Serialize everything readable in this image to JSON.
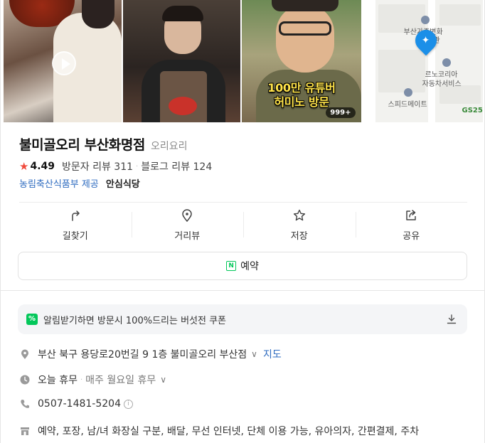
{
  "photos": {
    "caption_line1": "100만 유튜버",
    "caption_line2": "허미노 방문",
    "more_count": "999+",
    "map_labels": {
      "label1": "부산가족변화",
      "label1b": "관",
      "label2": "르노코리아",
      "label2b": "자동차서비스",
      "label3": "스피드메이트",
      "label4": "GS25"
    }
  },
  "place": {
    "name": "불미골오리 부산화명점",
    "category": "오리요리",
    "rating": "4.49",
    "visitor_reviews": "방문자 리뷰 311",
    "blog_reviews": "블로그 리뷰 124",
    "provider": "농림축산식품부 제공",
    "provider_badge": "안심식당"
  },
  "actions": {
    "directions": "길찾기",
    "street_view": "거리뷰",
    "save": "저장",
    "share": "공유",
    "reserve": "예약",
    "reserve_icon_letter": "N"
  },
  "coupon": {
    "icon": "%",
    "text": "알림받기하면 방문시 100%드리는 버섯전 쿠폰"
  },
  "info": {
    "address": "부산 북구 용당로20번길 9 1층 불미골오리 부산점",
    "map_link": "지도",
    "status": "오늘 휴무",
    "hours_note": "매주 월요일 휴무",
    "phone": "0507-1481-5204",
    "amenities": "예약, 포장, 남/녀 화장실 구분, 배달, 무선 인터넷, 단체 이용 가능, 유아의자, 간편결제, 주차"
  },
  "colors": {
    "accent_green": "#03c75a",
    "star_red": "#f04a3c",
    "link_blue": "#2f6cc0",
    "map_pin": "#1b8fe8"
  }
}
